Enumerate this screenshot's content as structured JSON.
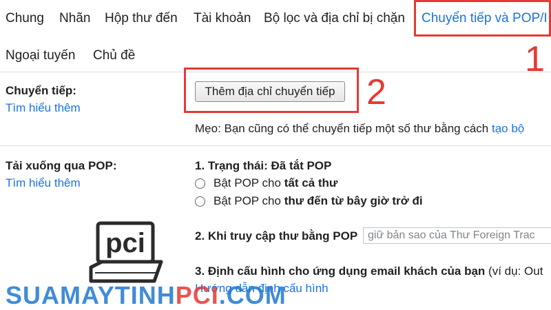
{
  "tabs": {
    "row1": [
      {
        "label": "Chung"
      },
      {
        "label": "Nhãn"
      },
      {
        "label": "Hộp thư đến"
      },
      {
        "label": "Tài khoản"
      },
      {
        "label": "Bộ lọc và địa chỉ bị chặn"
      },
      {
        "label": "Chuyển tiếp và POP/I"
      }
    ],
    "row2": [
      {
        "label": "Ngoại tuyến"
      },
      {
        "label": "Chủ đề"
      }
    ],
    "active_index": 5
  },
  "annotations": {
    "one": "1",
    "two": "2"
  },
  "forwarding": {
    "label": "Chuyển tiếp:",
    "learn_more": "Tìm hiểu thêm",
    "add_button": "Thêm địa chỉ chuyển tiếp",
    "tip_text": "Mẹo: Bạn cũng có thể chuyển tiếp một số thư bằng cách",
    "tip_link": "tạo bộ"
  },
  "pop": {
    "label": "Tải xuống qua POP:",
    "learn_more": "Tìm hiểu thêm",
    "status_prefix": "1. Trạng thái: Đã tắt POP",
    "option1_prefix": "Bật POP cho",
    "option1_bold": "tất cả thư",
    "option2_prefix": "Bật POP cho",
    "option2_bold": "thư đến từ bây giờ trở đi",
    "access_label": "2. Khi truy cập thư bằng POP",
    "access_select_value": "giữ bản sao của Thư Foreign Trac",
    "configure_label": "3. Định cấu hình cho ứng dụng email khách của bạn",
    "configure_suffix": "(ví dụ: Out",
    "configure_link": "Hướng dẫn định cấu hình"
  },
  "watermark": {
    "part1": "SUAMAYTINH",
    "part2": "PCI",
    "part3": ".COM",
    "logo_text": "pci"
  },
  "colors": {
    "accent": "#1a73e8",
    "annotation": "#e53935",
    "divider": "#dadce0"
  }
}
